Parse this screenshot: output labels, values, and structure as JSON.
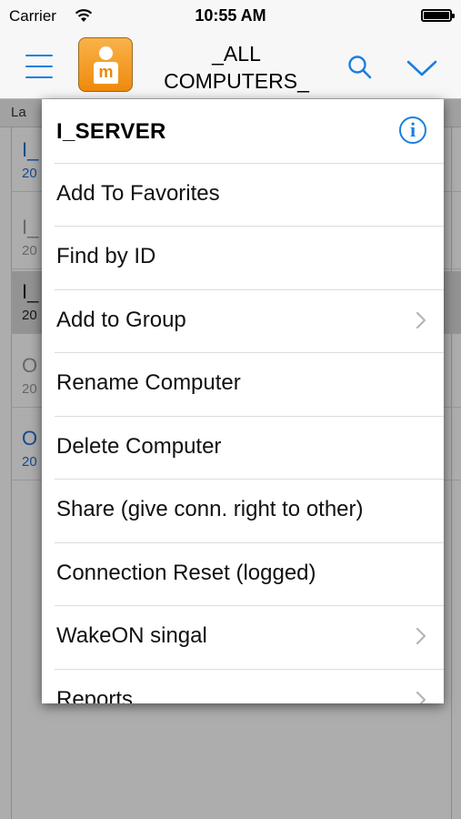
{
  "status_bar": {
    "carrier": "Carrier",
    "time": "10:55 AM"
  },
  "navbar": {
    "title": "_ALL COMPUTERS_"
  },
  "background_list": {
    "sort_label": "La",
    "rows": [
      {
        "title": "I_",
        "date": "20"
      },
      {
        "title": "I_",
        "date": "20"
      },
      {
        "title": "I_",
        "date": "20"
      },
      {
        "title": "O",
        "date": "20"
      },
      {
        "title": "O",
        "date": "20"
      }
    ]
  },
  "popup": {
    "title": "I_SERVER",
    "items": [
      {
        "label": "Add To Favorites",
        "has_submenu": false
      },
      {
        "label": "Find by ID",
        "has_submenu": false
      },
      {
        "label": "Add to Group",
        "has_submenu": true
      },
      {
        "label": "Rename Computer",
        "has_submenu": false
      },
      {
        "label": "Delete Computer",
        "has_submenu": false
      },
      {
        "label": "Share (give conn. right to other)",
        "has_submenu": false
      },
      {
        "label": "Connection Reset (logged)",
        "has_submenu": false
      },
      {
        "label": "WakeON singal",
        "has_submenu": true
      },
      {
        "label": "Reports",
        "has_submenu": true
      }
    ]
  },
  "colors": {
    "accent": "#1a7fe0",
    "logo": "#ef8a0c"
  }
}
